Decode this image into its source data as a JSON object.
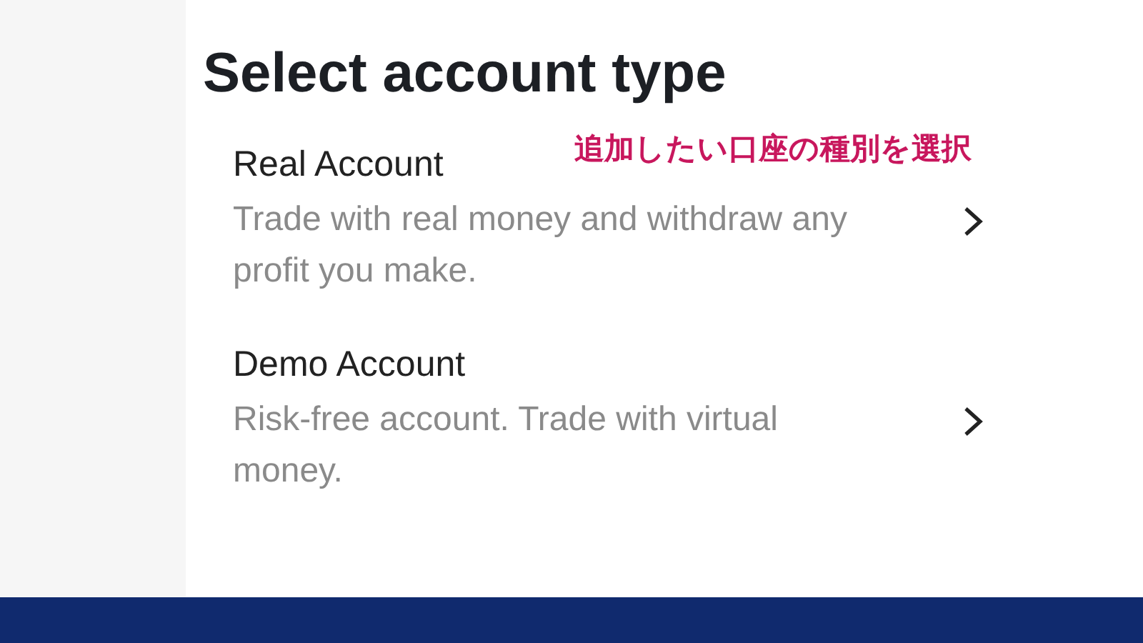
{
  "title": "Select account type",
  "annotation": "追加したい口座の種別を選択",
  "options": [
    {
      "name": "Real Account",
      "description": "Trade with real money and withdraw any profit you make."
    },
    {
      "name": "Demo Account",
      "description": "Risk-free account. Trade with virtual money."
    }
  ]
}
